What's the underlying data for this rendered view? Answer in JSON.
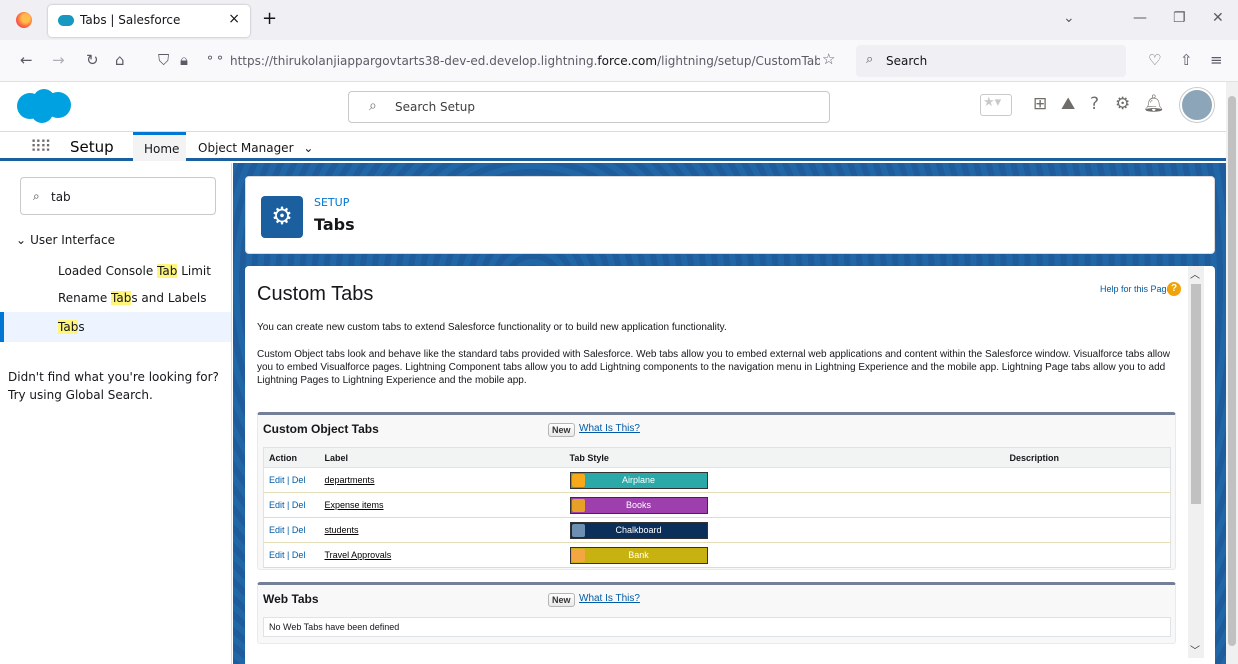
{
  "browser": {
    "tab_title": "Tabs | Salesforce",
    "tab_close": "×",
    "new_tab": "+",
    "url_prefix": "https://thirukolanjiappargovtarts38-dev-ed.develop.lightning.",
    "url_domain": "force.com",
    "url_suffix": "/lightning/setup/CustomTabs/page?",
    "search_placeholder": "Search",
    "win_minimize": "—",
    "win_restore": "❐",
    "win_close": "✕",
    "tab_list": "⌄"
  },
  "sf_header": {
    "search_placeholder": "Search Setup"
  },
  "nav": {
    "app_name": "Setup",
    "home": "Home",
    "object_manager": "Object Manager"
  },
  "sidebar": {
    "quickfind_value": "tab",
    "group": "User Interface",
    "items": [
      {
        "pre": "Loaded Console ",
        "hl": "Tab",
        "post": " Limit"
      },
      {
        "pre": "Rename ",
        "hl": "Tab",
        "post": "s and Labels"
      },
      {
        "pre": "",
        "hl": "Tab",
        "post": "s"
      }
    ],
    "not_found_line1": "Didn't find what you're looking for?",
    "not_found_line2": "Try using Global Search."
  },
  "page_header": {
    "breadcrumb": "SETUP",
    "title": "Tabs"
  },
  "content": {
    "title": "Custom Tabs",
    "help_link": "Help for this Page",
    "intro": "You can create new custom tabs to extend Salesforce functionality or to build new application functionality.",
    "desc": "Custom Object tabs look and behave like the standard tabs provided with Salesforce. Web tabs allow you to embed external web applications and content within the Salesforce window. Visualforce tabs allow you to embed Visualforce pages. Lightning Component tabs allow you to add Lightning components to the navigation menu in Lightning Experience and the mobile app. Lightning Page tabs allow you to add Lightning Pages to Lightning Experience and the mobile app.",
    "custom_object_tabs": {
      "heading": "Custom Object Tabs",
      "new_button": "New",
      "what_is_this": "What Is This?",
      "columns": [
        "Action",
        "Label",
        "Tab Style",
        "Description"
      ],
      "edit": "Edit",
      "sep": " | ",
      "del": "Del",
      "rows": [
        {
          "label": "departments",
          "style": "Airplane",
          "color": "#2ba9a9",
          "swatch": "#f7a81b"
        },
        {
          "label": "Expense items",
          "style": "Books",
          "color": "#9e3fae",
          "swatch": "#e8a127"
        },
        {
          "label": "students",
          "style": "Chalkboard",
          "color": "#0a2f5a",
          "swatch": "#6d8fb1"
        },
        {
          "label": "Travel Approvals",
          "style": "Bank",
          "color": "#c8b211",
          "swatch": "#f4a640"
        }
      ]
    },
    "web_tabs": {
      "heading": "Web Tabs",
      "new_button": "New",
      "what_is_this": "What Is This?",
      "empty": "No Web Tabs have been defined"
    }
  }
}
